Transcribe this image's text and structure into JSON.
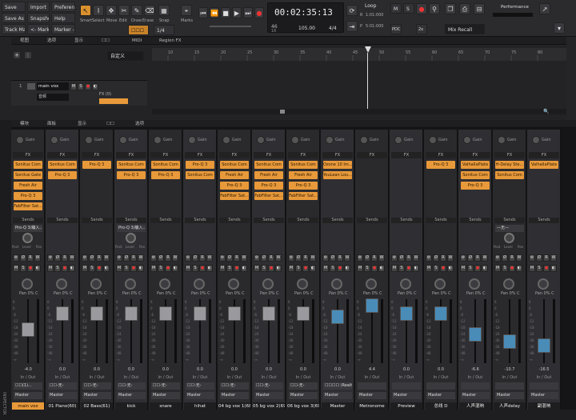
{
  "toolbar": {
    "file_buttons": [
      "Save",
      "Import",
      "Preferenc...",
      "Save As",
      "Snapshot",
      "Help",
      "Track Ma...",
      "<- Marker",
      "Marker ->"
    ],
    "tools": [
      "Smart",
      "Select",
      "Move",
      "Edit",
      "Draw",
      "Erase",
      "Snap",
      "Marks"
    ],
    "snap_value": "1/4",
    "snap_extra": "☐☐☐",
    "time": "00:02:35:13",
    "bars_beats": "46",
    "bars_beats_sub": "16",
    "tempo": "105.00",
    "time_sig": "4/4",
    "loop_label": "Loop",
    "loop_in": "1:01:000",
    "loop_out": "5:01:000",
    "loop_row_labels": [
      "R",
      "P"
    ],
    "transport_mini": [
      "M",
      "S",
      "PDC",
      "2x"
    ],
    "mix_recall": "Mix Recall",
    "performance_label": "Performance"
  },
  "arrange": {
    "tabs": [
      "视图",
      "选项",
      "显示",
      "☐☐",
      "MIDI",
      "Region FX"
    ],
    "timebase": "自定义",
    "track": {
      "number": "1",
      "name": "main vox",
      "sub": "音频",
      "fx_label": "FX (0)",
      "buttons": [
        "M",
        "S"
      ]
    },
    "ruler_marks": [
      "10",
      "15",
      "20",
      "25",
      "30",
      "35",
      "40",
      "45",
      "50",
      "55",
      "60",
      "65",
      "70",
      "75",
      "80"
    ]
  },
  "mixer": {
    "tabs": [
      "模块",
      "面板",
      "显示",
      "☐☐",
      "选项"
    ],
    "channels": [
      {
        "name": "main vox",
        "num": "1",
        "fx": [
          "Sonitus Com",
          "Sonitus Gate",
          "Fresh Air",
          "Pro-Q 3",
          "FabFilter Sat..."
        ],
        "send": "Pro-Q 3/编入...",
        "vol": "-4.0",
        "io": [
          "☐☐(1)...",
          "Master"
        ],
        "fader": 0.48,
        "selected": true
      },
      {
        "name": "01 Piano(60)",
        "num": "2",
        "fx": [
          "Sonitus Com",
          "Pro-Q 3"
        ],
        "send": "",
        "vol": "0.0",
        "io": [
          "☐☐-无-",
          "Master"
        ],
        "fader": 0.22
      },
      {
        "name": "02 Bass(61)",
        "num": "3",
        "fx": [
          "Pro-Q 3"
        ],
        "send": "",
        "vol": "0.0",
        "io": [
          "☐☐-无-",
          "Master"
        ],
        "fader": 0.22
      },
      {
        "name": "kick",
        "num": "4",
        "fx": [
          "Sonitus Com",
          "Pro-Q 3"
        ],
        "send": "Pro-Q 3/编入...",
        "vol": "0.0",
        "io": [
          "☐☐-无-",
          "Master"
        ],
        "fader": 0.22
      },
      {
        "name": "snare",
        "num": "5",
        "fx": [
          "Sonitus Com",
          "Pro-Q 3"
        ],
        "send": "",
        "vol": "0.0",
        "io": [
          "☐☐-无-",
          "Master"
        ],
        "fader": 0.22
      },
      {
        "name": "hihat",
        "num": "6",
        "fx": [
          "Pro-Q 3",
          "Sonitus Com"
        ],
        "send": "",
        "vol": "0.0",
        "io": [
          "☐☐-无-",
          "Master"
        ],
        "fader": 0.22
      },
      {
        "name": "04 bg vox 1(68)",
        "num": "7",
        "fx": [
          "Sonitus Com",
          "Fresh Air",
          "Pro-Q 3",
          "FabFilter Sat..."
        ],
        "send": "",
        "vol": "0.0",
        "io": [
          "☐☐-无-",
          "Master"
        ],
        "fader": 0.22
      },
      {
        "name": "05 bg vox 2(69)",
        "num": "8",
        "fx": [
          "Sonitus Com",
          "Fresh Air",
          "Pro-Q 3",
          "FabFilter Sat..."
        ],
        "send": "",
        "vol": "0.0",
        "io": [
          "☐☐-无-",
          "Master"
        ],
        "fader": 0.22
      },
      {
        "name": "06 bg vox 3(69)",
        "num": "9",
        "fx": [
          "Sonitus Com",
          "Fresh Air",
          "Pro-Q 3",
          "FabFilter Sat..."
        ],
        "send": "",
        "vol": "0.0",
        "io": [
          "☐☐-无-",
          "Master"
        ],
        "fader": 0.22
      },
      {
        "name": "Master",
        "num": "A",
        "fx": [
          "Ozone 10 Im...",
          "YouLean Lou..."
        ],
        "send": "",
        "vol": "0.0",
        "io": [
          "☐☐☐☐ (Realt...",
          "Master"
        ],
        "fader": 0.28,
        "blue": true
      },
      {
        "name": "Metronome",
        "num": "B",
        "fx": [],
        "send": "",
        "vol": "4.4",
        "io": [
          "",
          "Master"
        ],
        "fader": 0.1,
        "blue": true
      },
      {
        "name": "Preview",
        "num": "C",
        "fx": [],
        "send": "",
        "vol": "0.0",
        "io": [
          "",
          "Master"
        ],
        "fader": 0.22,
        "blue": true
      },
      {
        "name": "总线 D",
        "num": "D",
        "fx": [
          "Pro-Q 3"
        ],
        "send": "",
        "vol": "0.0",
        "io": [
          "",
          "Master"
        ],
        "fader": 0.22,
        "blue": true
      },
      {
        "name": "人声混响",
        "num": "E",
        "fx": [
          "ValhallaPlate",
          "Sonitus Com",
          "Pro-Q 3"
        ],
        "send": "",
        "vol": "-6.6",
        "io": [
          "",
          "Master"
        ],
        "fader": 0.55,
        "blue": true
      },
      {
        "name": "人声delay",
        "num": "F",
        "fx": [
          "H-Delay Ste...",
          "Sonitus Com"
        ],
        "send": "—无—",
        "vol": "-10.7",
        "io": [
          "",
          "Master"
        ],
        "fader": 0.66,
        "blue": true
      },
      {
        "name": "副混响",
        "num": "G",
        "fx": [
          "ValhallaPlate"
        ],
        "send": "",
        "vol": "-16.5",
        "io": [
          "",
          "Master"
        ],
        "fader": 0.72,
        "blue": true
      }
    ],
    "labels": {
      "gain": "Gain",
      "fx": "FX",
      "sends": "Sends",
      "pan": "Pan  0% C",
      "in_out": "In / Out"
    },
    "post_label": "Post",
    "level_label": "Level",
    "pan_label": "Pan"
  },
  "colors": {
    "accent": "#e8993a",
    "wave": "#3aa7d0",
    "bg": "#1a1a1c"
  }
}
